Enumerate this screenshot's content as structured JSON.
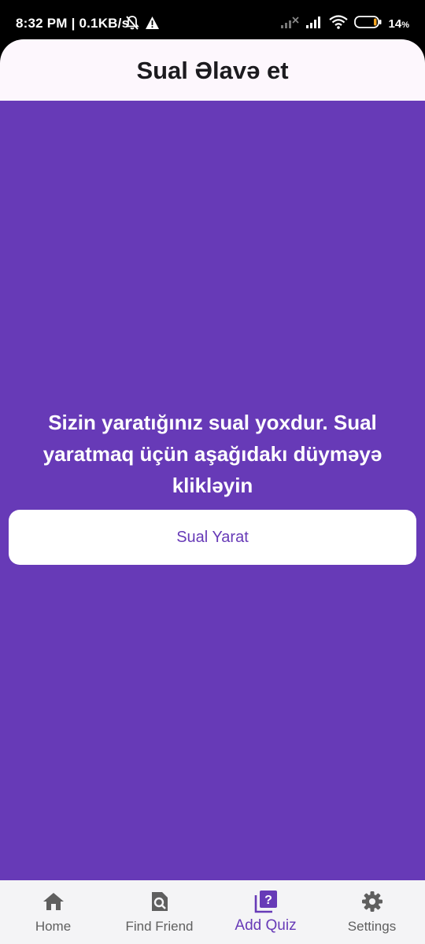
{
  "status_bar": {
    "time": "8:32 PM",
    "network_speed": "0.1KB/s",
    "battery": "14",
    "battery_unit": "%",
    "icons": [
      "muted-bell-icon",
      "warning-icon",
      "signal-x-icon",
      "signal-icon",
      "wifi-icon",
      "battery-icon"
    ]
  },
  "app_bar": {
    "title": "Sual Əlavə et"
  },
  "main": {
    "empty_message": "Sizin yaratığınız sual yoxdur. Sual yaratmaq üçün aşağıdakı düyməyə klikləyin",
    "create_button_label": "Sual Yarat"
  },
  "bottom_nav": {
    "items": [
      {
        "label": "Home",
        "icon": "home-icon"
      },
      {
        "label": "Find Friend",
        "icon": "find-friend-icon"
      },
      {
        "label": "Add Quiz",
        "icon": "add-quiz-icon",
        "active": true
      },
      {
        "label": "Settings",
        "icon": "settings-icon"
      }
    ]
  },
  "colors": {
    "primary": "#673ab7",
    "app_bar_background": "#fdf7fd",
    "nav_background": "#f4f4f6",
    "inactive_nav": "#5f5f5f"
  }
}
